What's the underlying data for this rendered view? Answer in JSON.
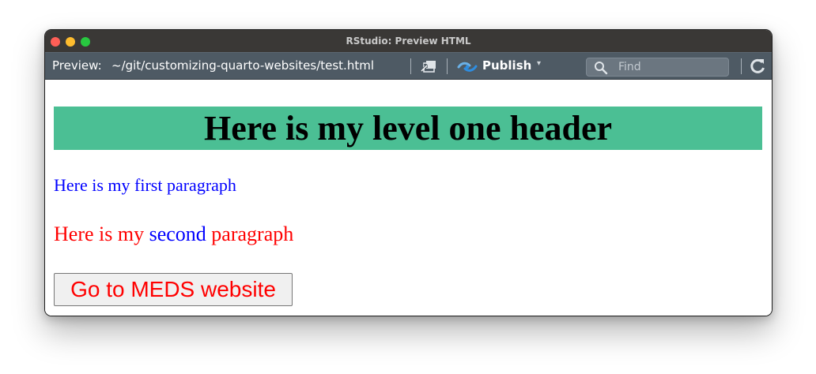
{
  "window": {
    "title": "RStudio: Preview HTML"
  },
  "toolbar": {
    "preview_label": "Preview:",
    "file_path": "~/git/customizing-quarto-websites/test.html",
    "publish_label": "Publish",
    "find_placeholder": "Find",
    "icons": [
      "popout-icon",
      "publish-icon",
      "chevron-down-icon",
      "search-icon",
      "refresh-icon"
    ]
  },
  "content": {
    "heading": "Here is my level one header",
    "paragraph_1": "Here is my first paragraph",
    "paragraph_2": {
      "part_1": "Here is my ",
      "part_2": "second",
      "part_3": " paragraph"
    },
    "button_label": "Go to MEDS website"
  },
  "colors": {
    "header_bg": "#4bbf94",
    "blue_text": "#0000ff",
    "red_text": "#ff0000",
    "toolbar_bg": "#4e5a64",
    "titlebar_bg": "#3a3836"
  }
}
